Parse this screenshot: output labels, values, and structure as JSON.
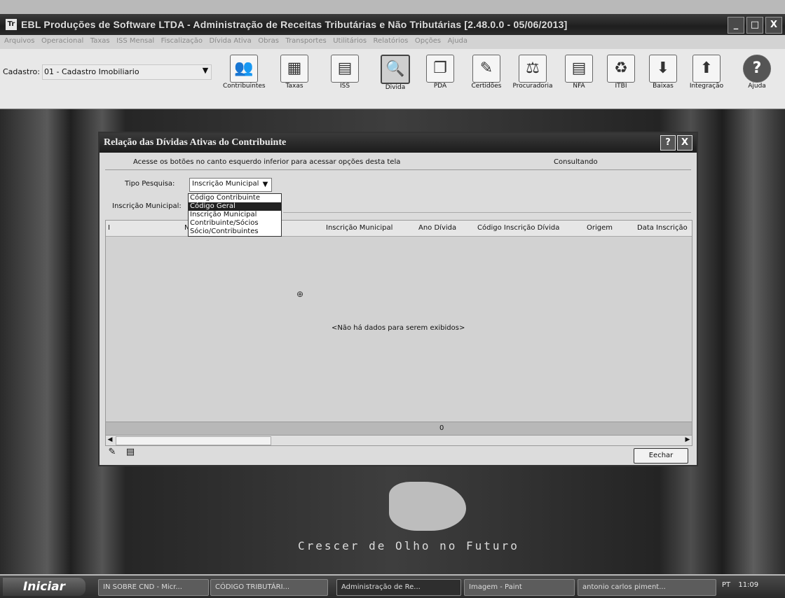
{
  "window": {
    "title": "EBL Produções de Software LTDA - Administração de Receitas Tributárias e Não Tributárias [2.48.0.0 - 05/06/2013]",
    "app_icon": "Tr",
    "minimize": "_",
    "maximize": "□",
    "close": "X"
  },
  "menu": [
    "Arquivos",
    "Operacional",
    "Taxas",
    "ISS Mensal",
    "Fiscalização",
    "Dívida Ativa",
    "Obras",
    "Transportes",
    "Utilitários",
    "Relatórios",
    "Opções",
    "Ajuda"
  ],
  "toolbar": {
    "cadastro_label": "Cadastro:",
    "cadastro_value": "01 - Cadastro Imobiliario",
    "buttons": [
      {
        "label": "Contribuintes",
        "icon": "people-icon",
        "glyph": "👥"
      },
      {
        "label": "Taxas",
        "icon": "receipt-icon",
        "glyph": "▦"
      },
      {
        "label": "ISS",
        "icon": "document-icon",
        "glyph": "▤"
      },
      {
        "label": "Divida",
        "icon": "search-doc-icon",
        "glyph": "🔍"
      },
      {
        "label": "PDA",
        "icon": "docs-icon",
        "glyph": "❐"
      },
      {
        "label": "Certidões",
        "icon": "certificate-icon",
        "glyph": "✎"
      },
      {
        "label": "Procuradoria",
        "icon": "scales-icon",
        "glyph": "⚖"
      },
      {
        "label": "NFA",
        "icon": "invoice-icon",
        "glyph": "▤"
      },
      {
        "label": "ITBI",
        "icon": "recycle-icon",
        "glyph": "♻"
      },
      {
        "label": "Baixas",
        "icon": "download-icon",
        "glyph": "⬇"
      },
      {
        "label": "Integração",
        "icon": "upload-icon",
        "glyph": "⬆"
      },
      {
        "label": "Ajuda",
        "icon": "help-icon",
        "glyph": "?"
      }
    ]
  },
  "dialog": {
    "title": "Relação das Dívidas Ativas do Contribuinte",
    "help": "?",
    "close": "X",
    "info_message": "Acesse os botões no canto esquerdo inferior para acessar opções desta tela",
    "status": "Consultando",
    "tipo_label": "Tipo Pesquisa:",
    "tipo_value": "Inscrição Municipal",
    "tipo_options": [
      "Código Contribuinte",
      "Código Geral",
      "Inscrição Municipal",
      "Contribuinte/Sócios",
      "Sócio/Contribuintes"
    ],
    "tipo_highlighted": "Código Geral",
    "inscricao_label": "Inscrição Municipal:",
    "columns": [
      "Inscrição Municipal",
      "Ano Dívida",
      "Código Inscrição Dívida",
      "Origem",
      "Data Inscrição"
    ],
    "column_stub": "N",
    "row_marker": "I",
    "no_data": "<Não há dados para serem exibidos>",
    "total": "0",
    "close_button": "Eechar"
  },
  "desktop": {
    "slogan": "Crescer de Olho no Futuro"
  },
  "taskbar": {
    "start": "Iniciar",
    "tasks": [
      "IN SOBRE CND - Micr...",
      "CÓDIGO TRIBUTÁRI...",
      "Administração de Re...",
      "Imagem - Paint",
      "antonio carlos piment..."
    ],
    "active_task": "Administração de Re...",
    "lang": "PT",
    "clock": "11:09"
  }
}
